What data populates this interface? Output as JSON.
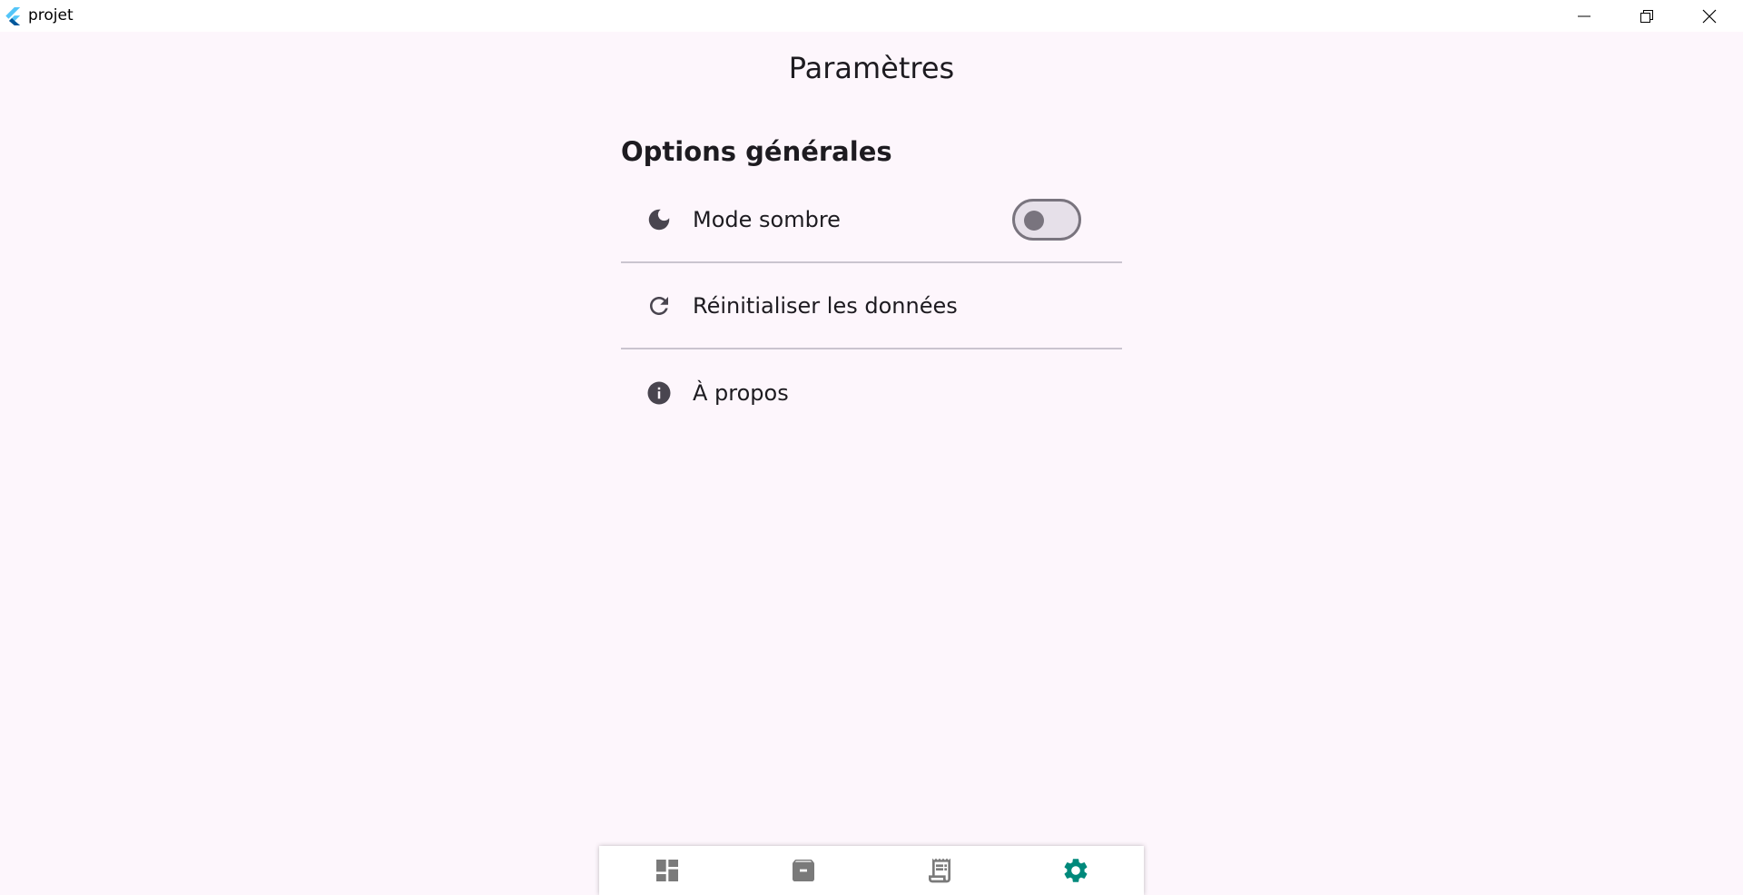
{
  "window": {
    "title": "projet",
    "controls": [
      "minimize",
      "restore",
      "close"
    ]
  },
  "page": {
    "title": "Paramètres"
  },
  "section": {
    "heading": "Options générales",
    "items": [
      {
        "icon": "moon-icon",
        "label": "Mode sombre",
        "toggle": false
      },
      {
        "icon": "refresh-icon",
        "label": "Réinitialiser les données"
      },
      {
        "icon": "info-icon",
        "label": "À propos"
      }
    ]
  },
  "bottom_nav": {
    "items": [
      {
        "icon": "dashboard-icon",
        "active": false
      },
      {
        "icon": "archive-icon",
        "active": false
      },
      {
        "icon": "receipt-icon",
        "active": false
      },
      {
        "icon": "settings-icon",
        "active": true
      }
    ],
    "active_color": "#00897b",
    "inactive_color": "#7a7a7a"
  }
}
